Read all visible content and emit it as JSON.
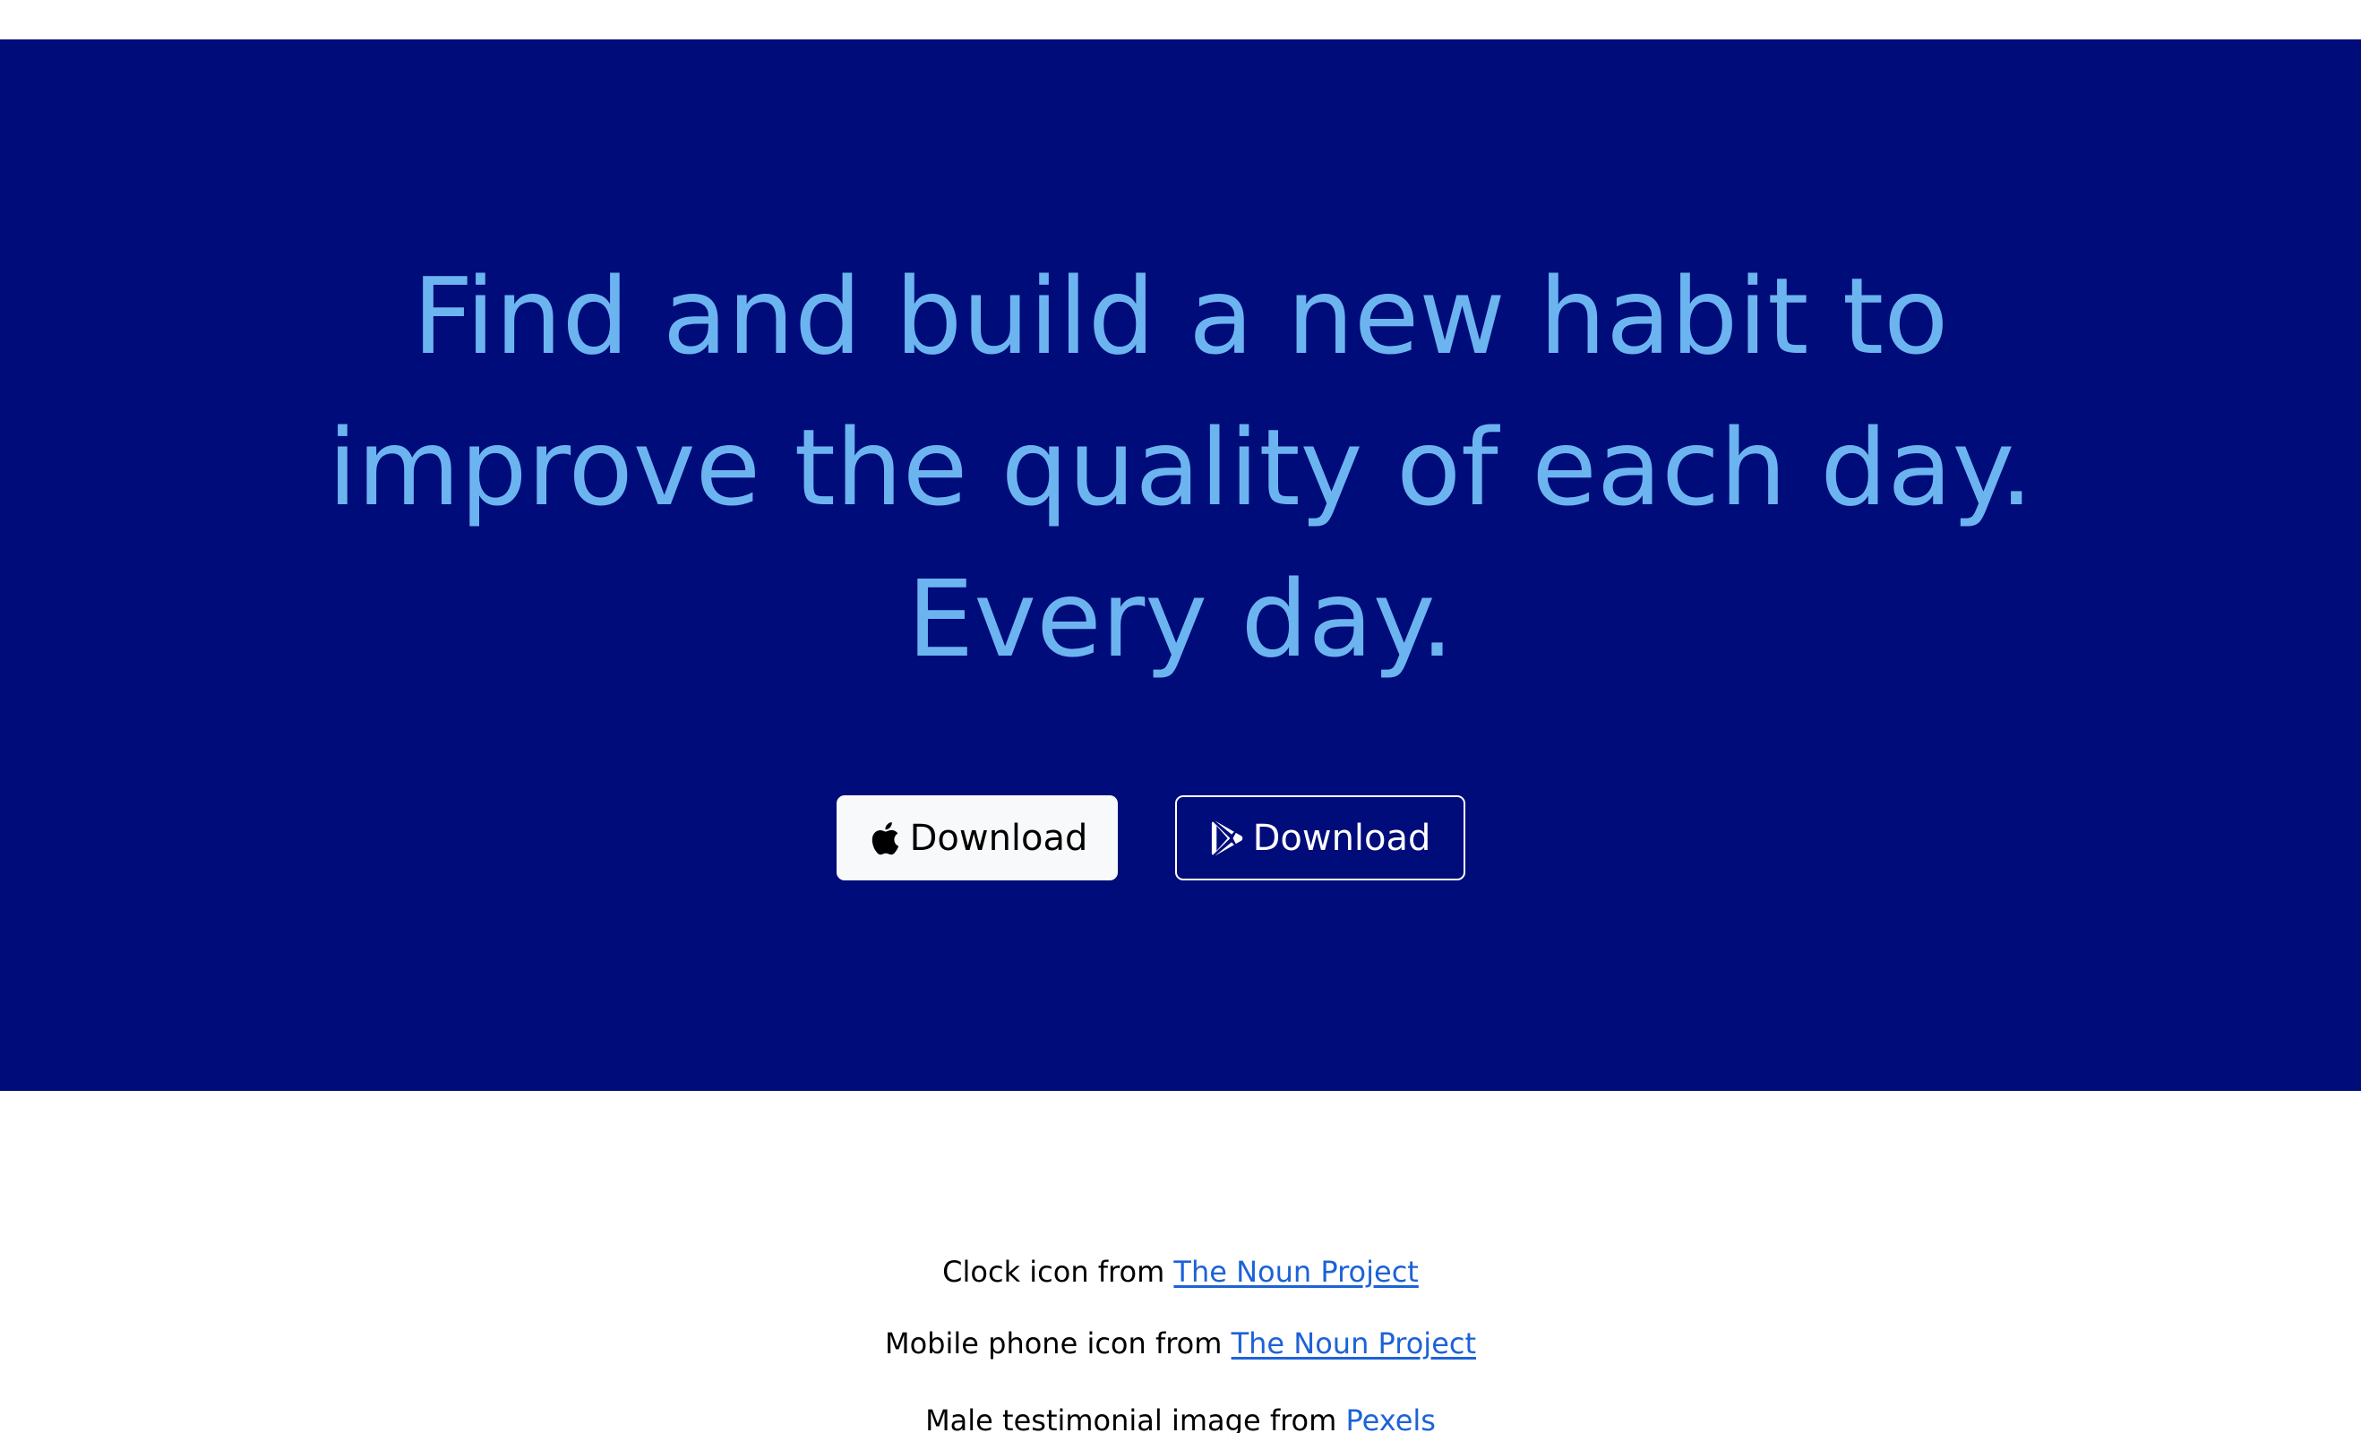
{
  "hero": {
    "headline_line1": "Find and build a new habit to",
    "headline_line2": "improve the quality of each day.",
    "headline_line3": "Every day.",
    "background_color": "#000c7a",
    "headline_color": "#6cb4f0",
    "buttons": [
      {
        "icon": "apple-icon",
        "label": "Download"
      },
      {
        "icon": "google-play-icon",
        "label": "Download"
      }
    ]
  },
  "credits": [
    {
      "prefix": "Clock icon from ",
      "link_text": "The Noun Project"
    },
    {
      "prefix": "Mobile phone icon from ",
      "link_text": "The Noun Project"
    },
    {
      "prefix": "Male testimonial image from ",
      "link_text": "Pexels"
    }
  ],
  "colors": {
    "link": "#1d62d8"
  }
}
